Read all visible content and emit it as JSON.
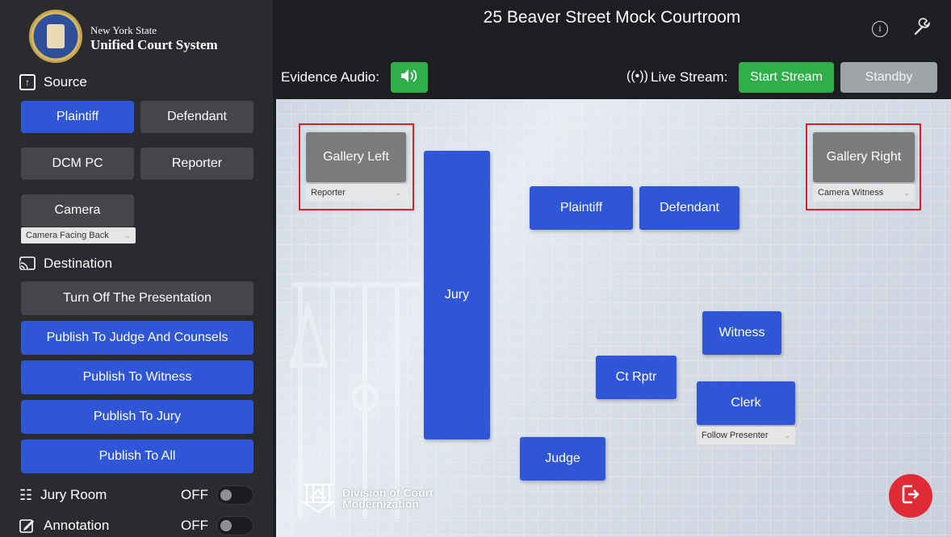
{
  "org": {
    "line1": "New York State",
    "line2": "Unified Court System"
  },
  "header": {
    "title": "25 Beaver Street Mock Courtroom"
  },
  "source": {
    "heading": "Source",
    "buttons": [
      "Plaintiff",
      "Defendant",
      "DCM PC",
      "Reporter",
      "Camera"
    ],
    "active": "Plaintiff",
    "camera_select": "Camera Facing Back"
  },
  "destination": {
    "heading": "Destination",
    "buttons": [
      "Turn Off The Presentation",
      "Publish To Judge And Counsels",
      "Publish To Witness",
      "Publish To Jury",
      "Publish To All"
    ]
  },
  "toggles": {
    "jury_room": {
      "label": "Jury Room",
      "state": "OFF"
    },
    "annotation": {
      "label": "Annotation",
      "state": "OFF"
    }
  },
  "toolbar": {
    "audio_label": "Evidence Audio:",
    "live_label": "Live Stream:",
    "start_stream": "Start Stream",
    "standby": "Standby"
  },
  "stage": {
    "gallery_left": {
      "label": "Gallery Left",
      "select": "Reporter"
    },
    "gallery_right": {
      "label": "Gallery Right",
      "select": "Camera Witness"
    },
    "jury": "Jury",
    "plaintiff": "Plaintiff",
    "defendant": "Defendant",
    "witness": "Witness",
    "ct_rptr": "Ct Rptr",
    "clerk": {
      "label": "Clerk",
      "select": "Follow Presenter"
    },
    "judge": "Judge"
  },
  "branding": {
    "line1": "Division of Court",
    "line2": "Modernization"
  },
  "colors": {
    "accent_blue": "#2f56d6",
    "stream_green": "#2fae49",
    "exit_red": "#e02b36",
    "selection_red": "#e0201f"
  }
}
